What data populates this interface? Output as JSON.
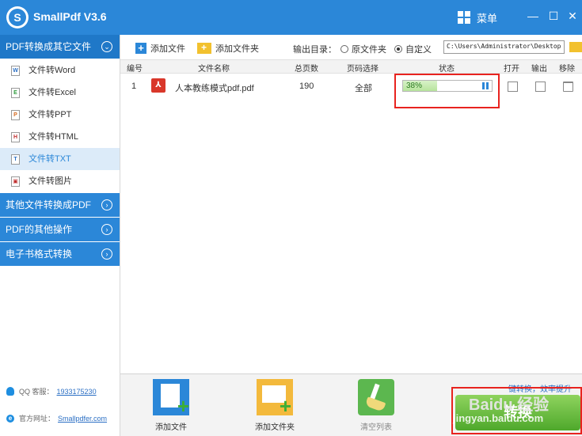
{
  "app": {
    "title": "SmallPdf V3.6",
    "menu_label": "菜单",
    "logo_letter": "S"
  },
  "window": {
    "minimize": "—",
    "maximize": "☐",
    "close": "✕"
  },
  "sidebar": {
    "active_category": "PDF转换成其它文件",
    "sub_items": [
      {
        "label": "文件转Word",
        "glyph": "W"
      },
      {
        "label": "文件转Excel",
        "glyph": "E"
      },
      {
        "label": "文件转PPT",
        "glyph": "P"
      },
      {
        "label": "文件转HTML",
        "glyph": "H"
      },
      {
        "label": "文件转TXT",
        "glyph": "T",
        "active": true
      },
      {
        "label": "文件转图片",
        "glyph": "▣"
      }
    ],
    "categories": [
      {
        "label": "其他文件转换成PDF"
      },
      {
        "label": "PDF的其他操作"
      },
      {
        "label": "电子书格式转换"
      }
    ],
    "contact": {
      "qq_label": "QQ 客服：",
      "qq_value": "1933175230",
      "site_label": "官方网址：",
      "site_value": "Smallpdfer.com"
    }
  },
  "toolbar": {
    "add_file": "添加文件",
    "add_folder": "添加文件夹",
    "output_label": "输出目录：",
    "radio_source": "原文件夹",
    "radio_custom": "自定义",
    "output_path": "C:\\Users\\Administrator\\Desktop"
  },
  "table": {
    "headers": {
      "index": "编号",
      "name": "文件名称",
      "pages": "总页数",
      "range": "页码选择",
      "status": "状态",
      "open": "打开",
      "output": "输出",
      "remove": "移除"
    },
    "rows": [
      {
        "index": "1",
        "name": "人本教练模式pdf.pdf",
        "pages": "190",
        "range": "全部",
        "progress_text": "38%",
        "progress": 0.38
      }
    ]
  },
  "bottom": {
    "add_file": "添加文件",
    "add_folder": "添加文件夹",
    "clear_list": "清空列表",
    "convert": "转换",
    "hint": "键转换，效率提升"
  },
  "watermark": {
    "text1": "Baidu 经验",
    "text2": "jingyan.baidu.com"
  },
  "colors": {
    "brand": "#2b87d8",
    "highlight": "#e8231f",
    "convert": "#5cb74f"
  }
}
